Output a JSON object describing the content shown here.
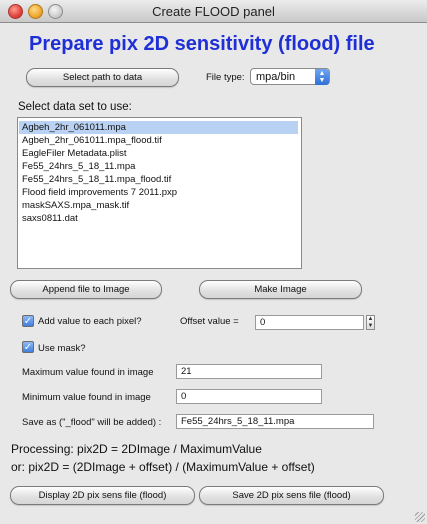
{
  "window": {
    "title": "Create FLOOD panel"
  },
  "heading": "Prepare pix 2D sensitivity (flood) file",
  "path_button_label": "Select path to data",
  "file_type": {
    "label": "File type:",
    "selected": "mpa/bin"
  },
  "dataset": {
    "label": "Select data set to use:",
    "items": [
      "Agbeh_2hr_061011.mpa",
      "Agbeh_2hr_061011.mpa_flood.tif",
      "EagleFiler Metadata.plist",
      "Fe55_24hrs_5_18_11.mpa",
      "Fe55_24hrs_5_18_11.mpa_flood.tif",
      "Flood field improvements 7 2011.pxp",
      "maskSAXS.mpa_mask.tif",
      "saxs0811.dat"
    ],
    "selected_index": 0
  },
  "buttons": {
    "append": "Append file to Image",
    "make": "Make Image",
    "display": "Display 2D pix sens file (flood)",
    "save": "Save 2D pix sens file (flood)"
  },
  "add_value": {
    "label": "Add value to each pixel?",
    "checked": true,
    "offset_label": "Offset value =",
    "offset_value": "0"
  },
  "use_mask": {
    "label": "Use mask?",
    "checked": true
  },
  "max_value": {
    "label": "Maximum value found in image",
    "value": "21"
  },
  "min_value": {
    "label": "Minimum value found in image",
    "value": "0"
  },
  "save_as": {
    "label": "Save as (\"_flood\" will be added) :",
    "value": "Fe55_24hrs_5_18_11.mpa"
  },
  "processing": {
    "line1": "Processing: pix2D = 2DImage / MaximumValue",
    "line2": "or: pix2D = (2DImage + offset) / (MaximumValue + offset)"
  },
  "colors": {
    "heading": "#1f2fd6",
    "selection": "#b9d1f2",
    "checkbox": "#3f7fe0"
  }
}
